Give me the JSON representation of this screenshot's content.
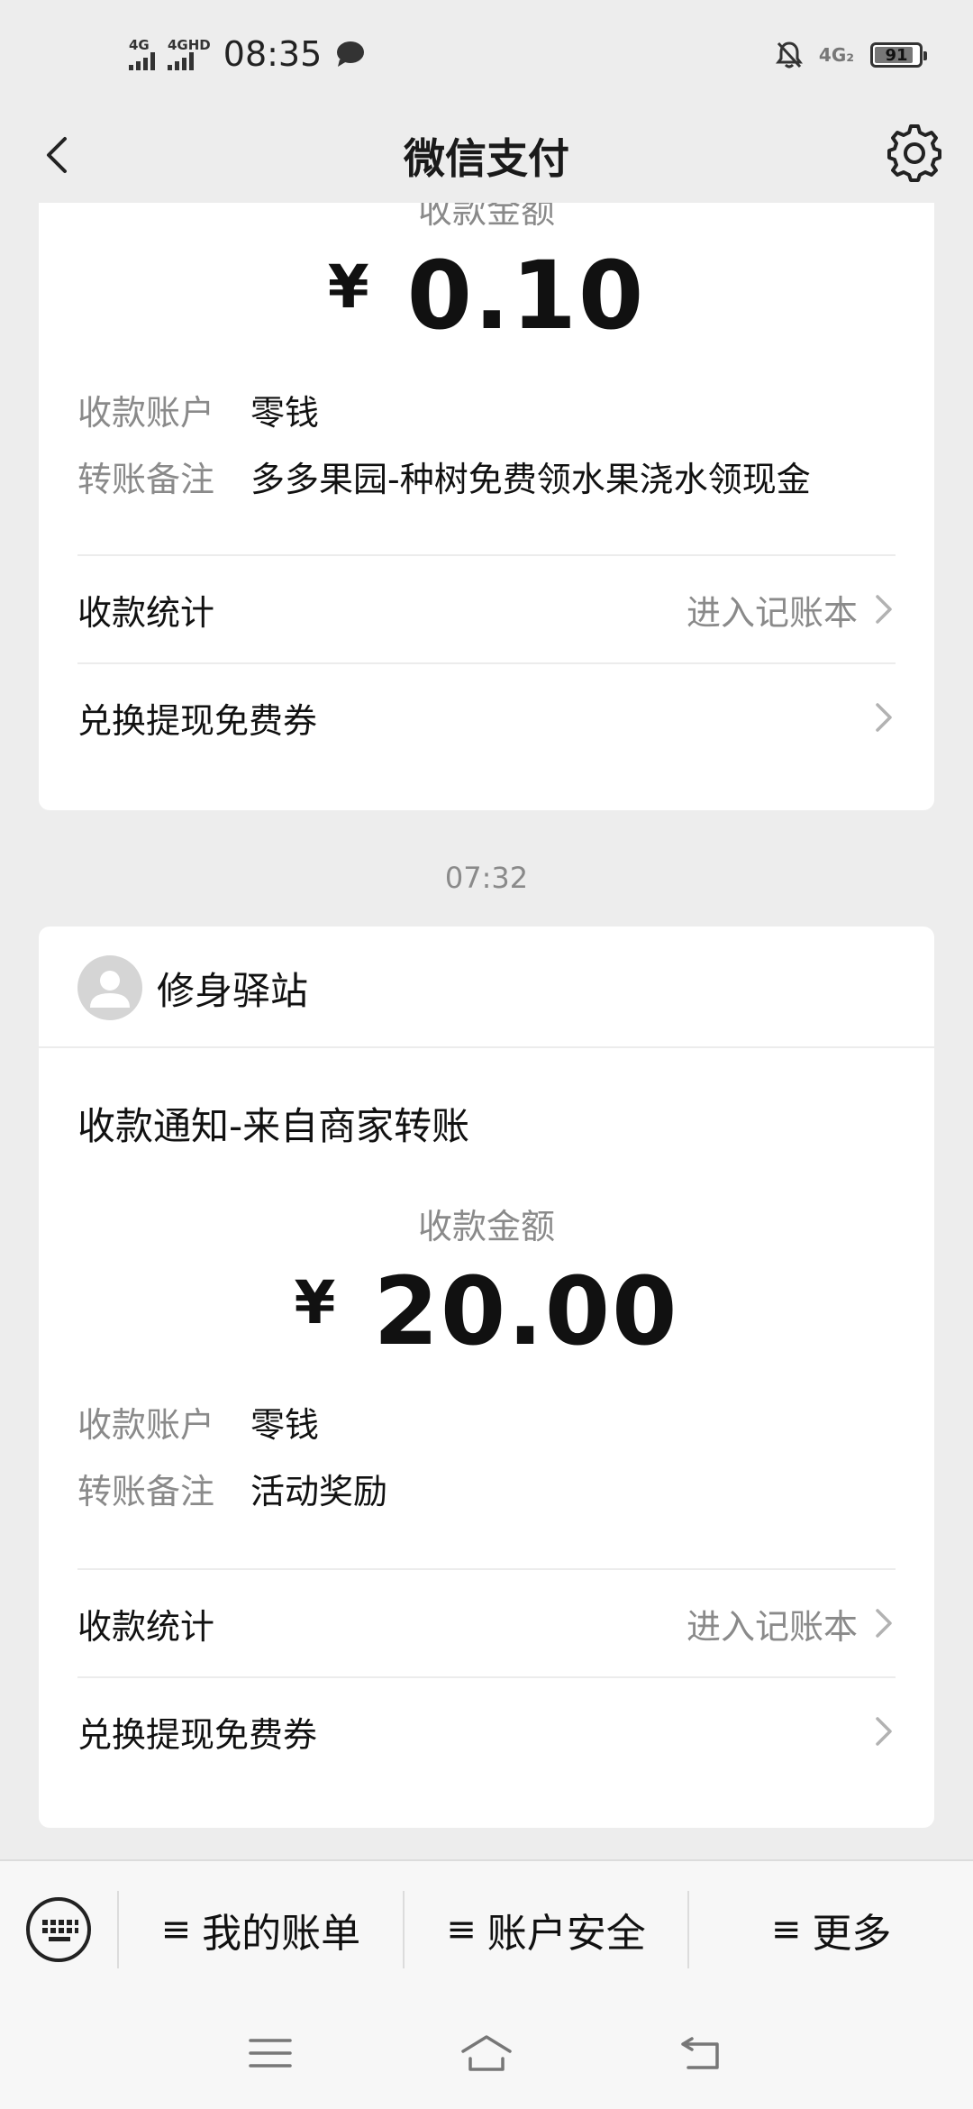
{
  "status_bar": {
    "time": "08:35",
    "signal1_label": "4G",
    "signal2_label": "4GHD",
    "network_right": "4G₂",
    "battery": "91"
  },
  "nav": {
    "title": "微信支付"
  },
  "card1": {
    "amount_label": "收款金额",
    "currency": "¥",
    "amount": "0.10",
    "account_key": "收款账户",
    "account_value": "零钱",
    "note_key": "转账备注",
    "note_value": "多多果园-种树免费领水果浇水领现金",
    "stats_label": "收款统计",
    "stats_link": "进入记账本",
    "coupon_label": "兑换提现免费券"
  },
  "timestamp": "07:32",
  "card2": {
    "merchant_name": "修身驿站",
    "title": "收款通知-来自商家转账",
    "amount_label": "收款金额",
    "currency": "¥",
    "amount": "20.00",
    "account_key": "收款账户",
    "account_value": "零钱",
    "note_key": "转账备注",
    "note_value": "活动奖励",
    "stats_label": "收款统计",
    "stats_link": "进入记账本",
    "coupon_label": "兑换提现免费券"
  },
  "bottom_menu": {
    "items": [
      {
        "icon": "≡",
        "label": "我的账单"
      },
      {
        "icon": "≡",
        "label": "账户安全"
      },
      {
        "icon": "≡",
        "label": "更多"
      }
    ]
  }
}
